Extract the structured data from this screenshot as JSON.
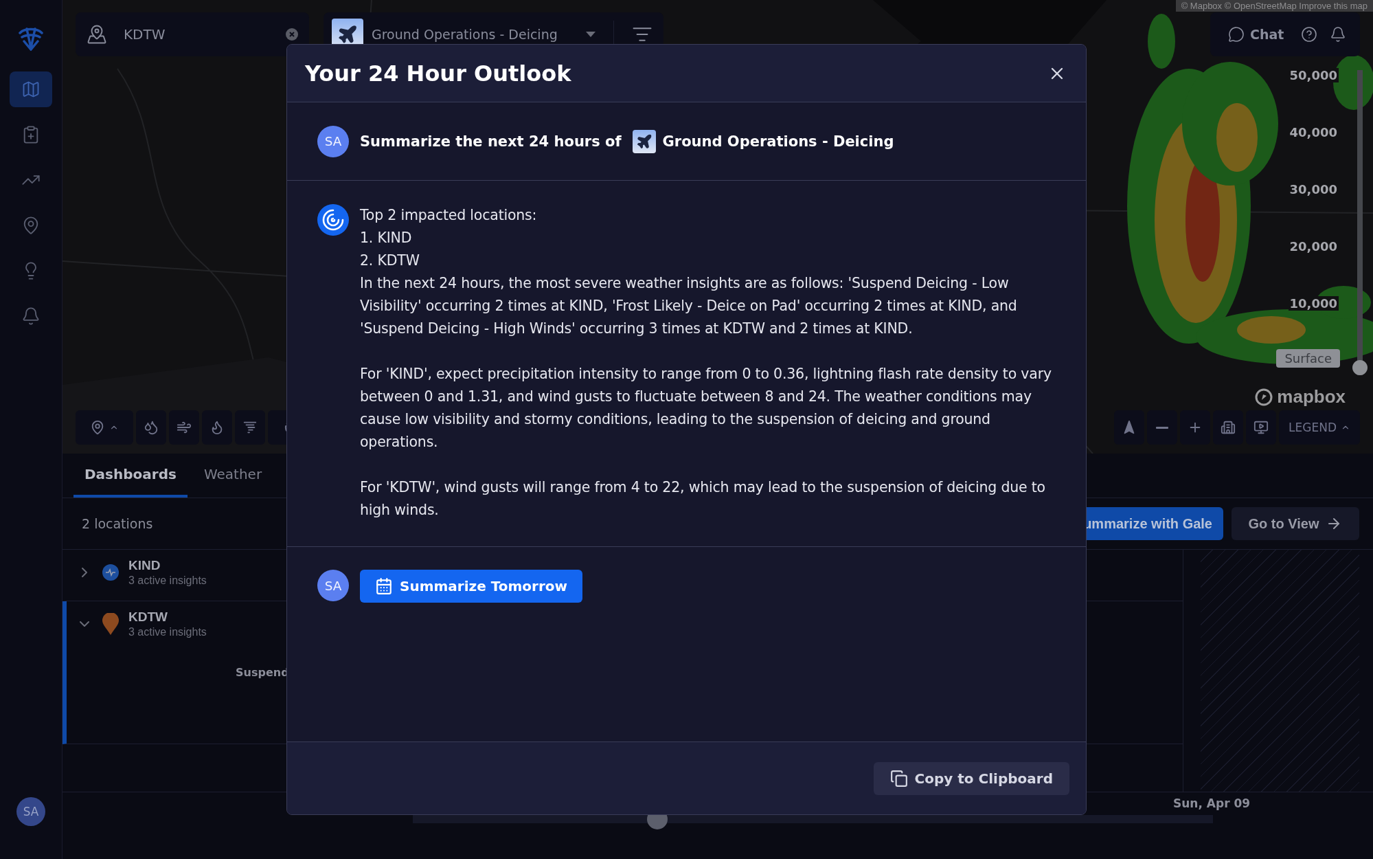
{
  "sidebar": {
    "nav_items": [
      {
        "kind": "map",
        "selected": true
      },
      {
        "kind": "report",
        "selected": false
      },
      {
        "kind": "trend",
        "selected": false
      },
      {
        "kind": "pin",
        "selected": false
      },
      {
        "kind": "bulb",
        "selected": false
      },
      {
        "kind": "bell",
        "selected": false
      }
    ],
    "avatar": "SA"
  },
  "map": {
    "search": {
      "value": "KDTW"
    },
    "layer_select": {
      "value": "Ground Operations - Deicing"
    },
    "attribution": "© Mapbox © OpenStreetMap Improve this map",
    "chat_button": "Chat",
    "altitude_slider": {
      "ticks": [
        "50,000",
        "40,000",
        "30,000",
        "20,000",
        "10,000"
      ],
      "level": 0,
      "label": "Surface"
    },
    "logo": "mapbox",
    "legend_button": "LEGEND"
  },
  "panel": {
    "tabs": [
      {
        "label": "Dashboards",
        "selected": true
      },
      {
        "label": "Weather",
        "selected": false
      }
    ],
    "count": "2 locations",
    "locations": [
      {
        "code": "KIND",
        "insights": "3 active insights",
        "expanded": false,
        "kind": "circle",
        "color": "#1d4f9e"
      },
      {
        "code": "KDTW",
        "insights": "3 active insights",
        "expanded": true,
        "kind": "pin",
        "color": "#8d4a1f"
      }
    ],
    "insight_label": "Suspend",
    "summarize_button": "ummarize with Gale",
    "go_to_view_button": "Go to View",
    "timeline_date": "Sun, Apr 09"
  },
  "modal": {
    "title": "Your 24 Hour Outlook",
    "prompt": {
      "avatar": "SA",
      "text": "Summarize the next 24 hours of",
      "dashboard": "Ground Operations - Deicing"
    },
    "answer": [
      {
        "lines": [
          "Top 2 impacted locations:",
          "1. KIND",
          "2. KDTW",
          "In the next 24 hours, the most severe weather insights are as follows: 'Suspend Deicing - Low Visibility' occurring 2 times at KIND, 'Frost Likely - Deice on Pad' occurring 2 times at KIND, and 'Suspend Deicing - High Winds' occurring 3 times at KDTW and 2 times at KIND."
        ]
      },
      {
        "lines": [
          "For 'KIND', expect precipitation intensity to range from 0 to 0.36, lightning flash rate density to vary between 0 and 1.31, and wind gusts to fluctuate between 8 and 24. The weather conditions may cause low visibility and stormy conditions, leading to the suspension of deicing and ground operations."
        ]
      },
      {
        "lines": [
          "For 'KDTW', wind gusts will range from 4 to 22, which may lead to the suspension of deicing due to high winds."
        ]
      }
    ],
    "action_avatar": "SA",
    "action_button": "Summarize Tomorrow",
    "copy_button": "Copy to Clipboard"
  }
}
